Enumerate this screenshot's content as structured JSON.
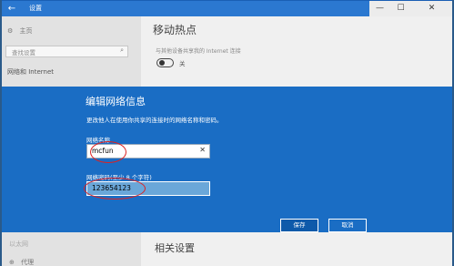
{
  "window": {
    "title": "设置",
    "back_icon": "back-arrow-icon",
    "controls": [
      "—",
      "☐",
      "✕"
    ]
  },
  "sidebar": {
    "home": "主页",
    "search_placeholder": "查找设置",
    "section": "网络和 Internet",
    "bottom_item": "以太网",
    "bottom_item2": "代理"
  },
  "main": {
    "title": "移动热点",
    "share_text": "与其他设备共享我的 Internet 连接",
    "toggle_label": "关",
    "toggle_state": "off",
    "related_title": "相关设置"
  },
  "dialog": {
    "title": "编辑网络信息",
    "description": "更改他人在使用你共享的连接时的网络名称和密码。",
    "name_label": "网络名称",
    "name_value": "mcfun",
    "password_label": "网络密码(至少 8 个字符)",
    "password_value": "123654123",
    "save": "保存",
    "cancel": "取消"
  },
  "colors": {
    "dialog_bg": "#1a6dc4",
    "titlebar": "#2b78d0",
    "annotation": "#dd2222"
  }
}
